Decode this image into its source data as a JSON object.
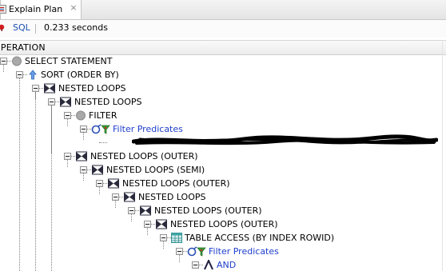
{
  "tab": {
    "title": "Explain Plan",
    "close": "×"
  },
  "toolbar": {
    "sql_link": "SQL",
    "separator": "|",
    "elapsed": "0.233 seconds"
  },
  "grid": {
    "column_header": "OPERATION"
  },
  "plan_nodes": [
    {
      "label": "SELECT STATEMENT",
      "icon": "statement-icon",
      "type": "op"
    },
    {
      "label": "SORT (ORDER BY)",
      "icon": "sort-icon",
      "type": "op"
    },
    {
      "label": "NESTED LOOPS",
      "icon": "nested-loops-icon",
      "type": "op"
    },
    {
      "label": "NESTED LOOPS",
      "icon": "nested-loops-icon",
      "type": "op"
    },
    {
      "label": "FILTER",
      "icon": "filter-icon",
      "type": "op"
    },
    {
      "label": "Filter Predicates",
      "icon": "filter-predicates-icon",
      "type": "predicate"
    },
    {
      "label": "",
      "icon": "redacted-scribble",
      "type": "redacted"
    },
    {
      "label": "NESTED LOOPS (OUTER)",
      "icon": "nested-loops-icon",
      "type": "op"
    },
    {
      "label": "NESTED LOOPS (SEMI)",
      "icon": "nested-loops-icon",
      "type": "op"
    },
    {
      "label": "NESTED LOOPS (OUTER)",
      "icon": "nested-loops-icon",
      "type": "op"
    },
    {
      "label": "NESTED LOOPS",
      "icon": "nested-loops-icon",
      "type": "op"
    },
    {
      "label": "NESTED LOOPS (OUTER)",
      "icon": "nested-loops-icon",
      "type": "op"
    },
    {
      "label": "NESTED LOOPS (OUTER)",
      "icon": "nested-loops-icon",
      "type": "op"
    },
    {
      "label": "TABLE ACCESS (BY INDEX ROWID)",
      "icon": "table-access-icon",
      "type": "op"
    },
    {
      "label": "Filter Predicates",
      "icon": "filter-predicates-icon",
      "type": "predicate"
    },
    {
      "label": "AND",
      "icon": "and-icon",
      "type": "predicate"
    }
  ]
}
